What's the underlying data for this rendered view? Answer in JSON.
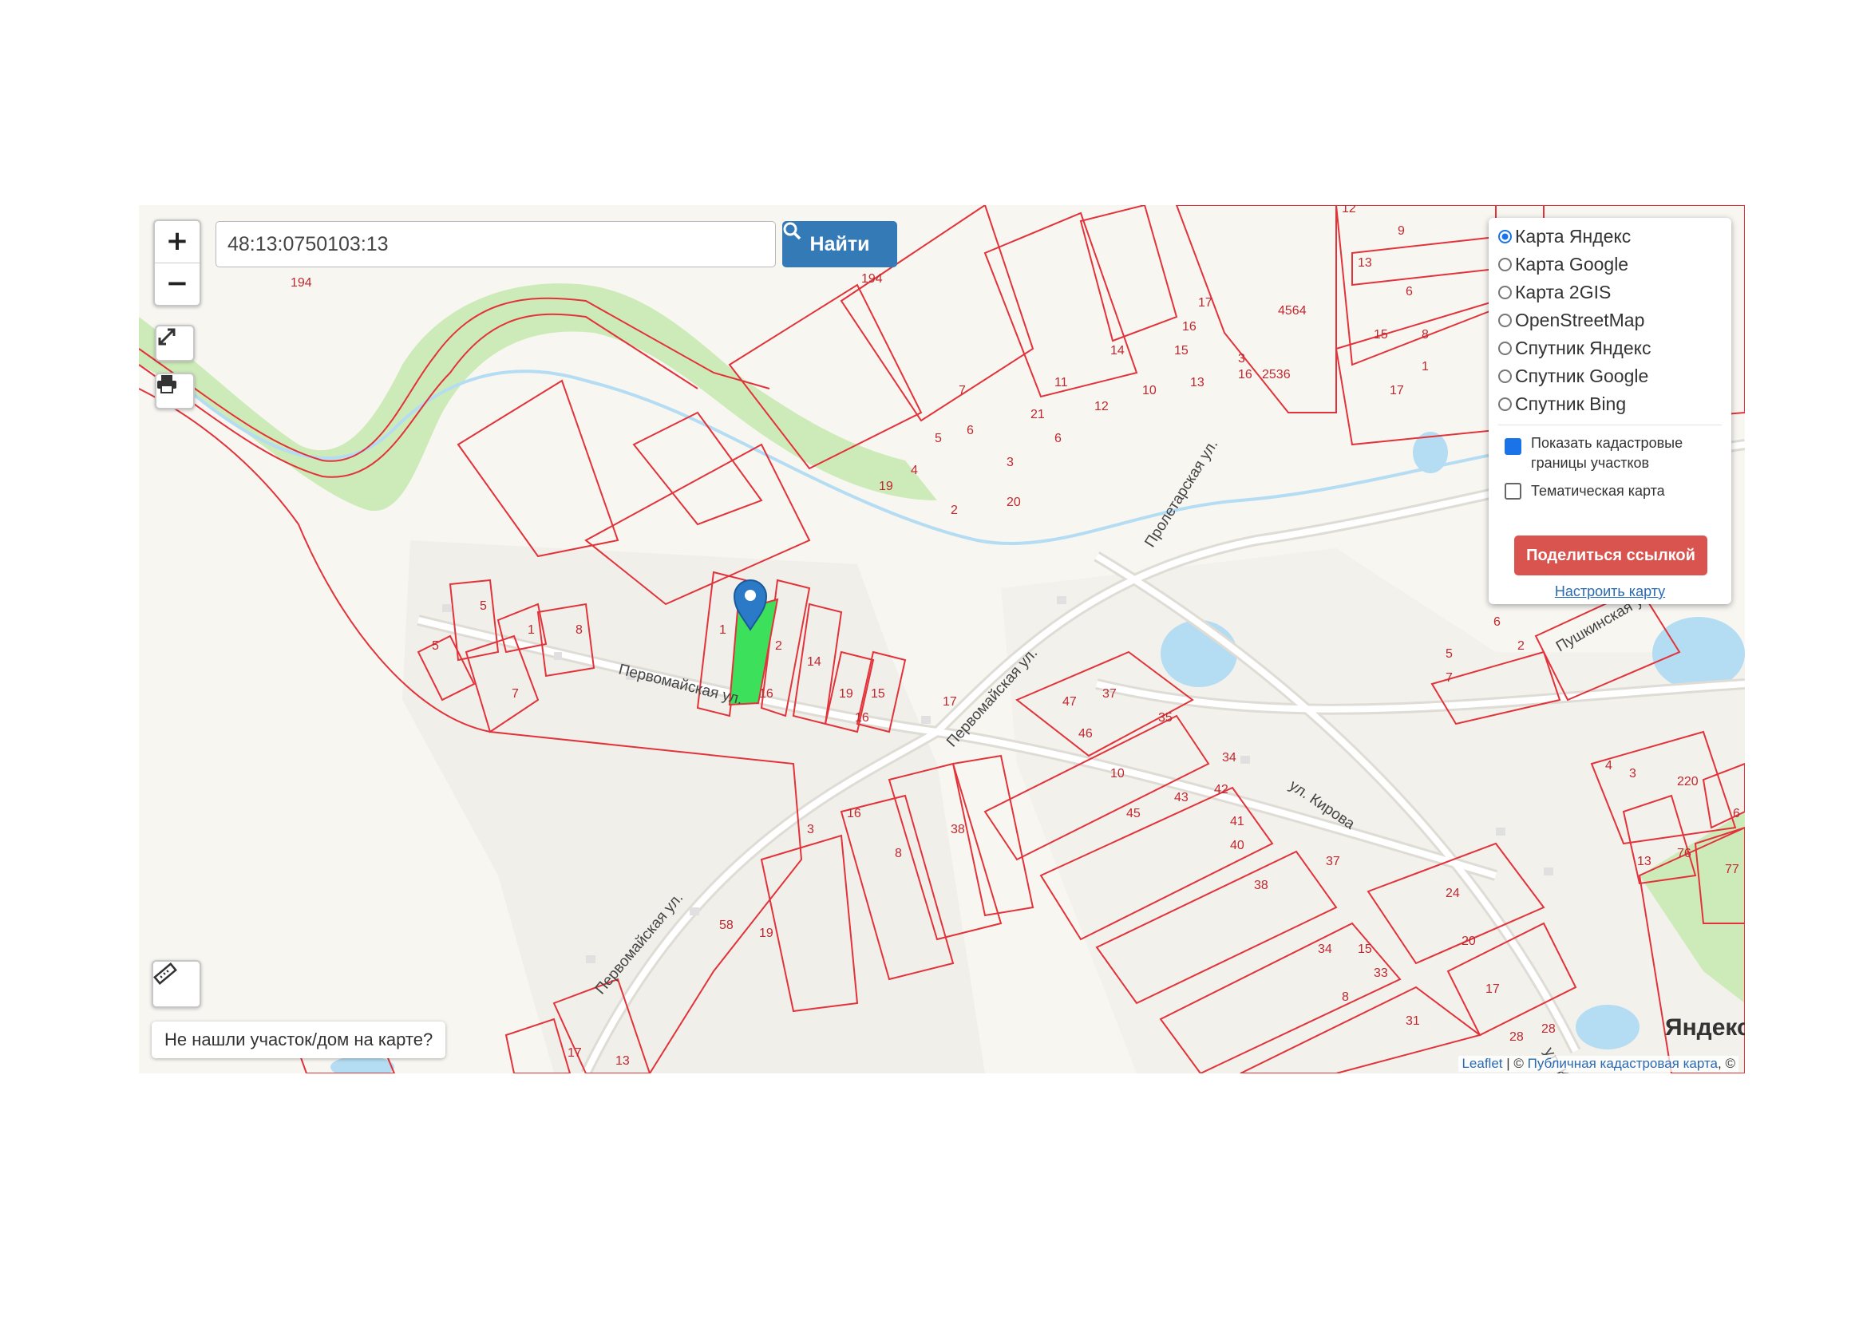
{
  "search": {
    "value": "48:13:0750103:13",
    "button_label": "Найти"
  },
  "zoom": {
    "in_label": "+",
    "out_label": "−"
  },
  "layers": {
    "options": [
      "Карта Яндекс",
      "Карта Google",
      "Карта 2GIS",
      "OpenStreetMap",
      "Спутник Яндекс",
      "Спутник Google",
      "Спутник Bing"
    ],
    "selected": "Карта Яндекс",
    "checkbox_cadastral": "Показать кадастровые границы участков",
    "checkbox_cadastral_checked": true,
    "checkbox_thematic": "Тематическая карта",
    "checkbox_thematic_checked": false,
    "share_button": "Поделиться ссылкой",
    "configure_link": "Настроить карту"
  },
  "not_found_button": "Не нашли участок/дом на карте?",
  "attribution": {
    "leaflet": "Leaflet",
    "sep": " | © ",
    "cadastral": "Публичная кадастровая карта",
    "tail": ", ©"
  },
  "provider_logo": "Яндекс",
  "map": {
    "streets": [
      "Первомайская ул.",
      "Первомайская ул.",
      "Первомайская ул.",
      "Пролетарская ул.",
      "ул. Кирова",
      "Пушкинская ул.",
      "ул. К"
    ],
    "parcel_labels": [
      "194",
      "194",
      "12",
      "9",
      "13",
      "6",
      "15",
      "8",
      "1",
      "17",
      "4564",
      "2536",
      "3",
      "16",
      "17",
      "16",
      "15",
      "13",
      "14",
      "11",
      "12",
      "10",
      "21",
      "6",
      "3",
      "7",
      "5",
      "6",
      "4",
      "19",
      "2",
      "20",
      "5",
      "8",
      "5",
      "7",
      "1",
      "1",
      "2",
      "14",
      "19",
      "15",
      "16",
      "16",
      "17",
      "47",
      "37",
      "46",
      "35",
      "10",
      "34",
      "45",
      "43",
      "42",
      "41",
      "40",
      "38",
      "37",
      "34",
      "15",
      "33",
      "8",
      "31",
      "28",
      "24",
      "20",
      "17",
      "3",
      "16",
      "8",
      "38",
      "19",
      "58",
      "17",
      "13",
      "5",
      "6",
      "2",
      "7",
      "4",
      "3",
      "220",
      "6",
      "13",
      "76",
      "77",
      "28"
    ],
    "water_color": "#b4dcf3",
    "forest_color": "#cdebb8",
    "parcel_line_color": "#e2323a",
    "selected_parcel_color": "#3de05a",
    "marker_color": "#2a7ac8"
  }
}
